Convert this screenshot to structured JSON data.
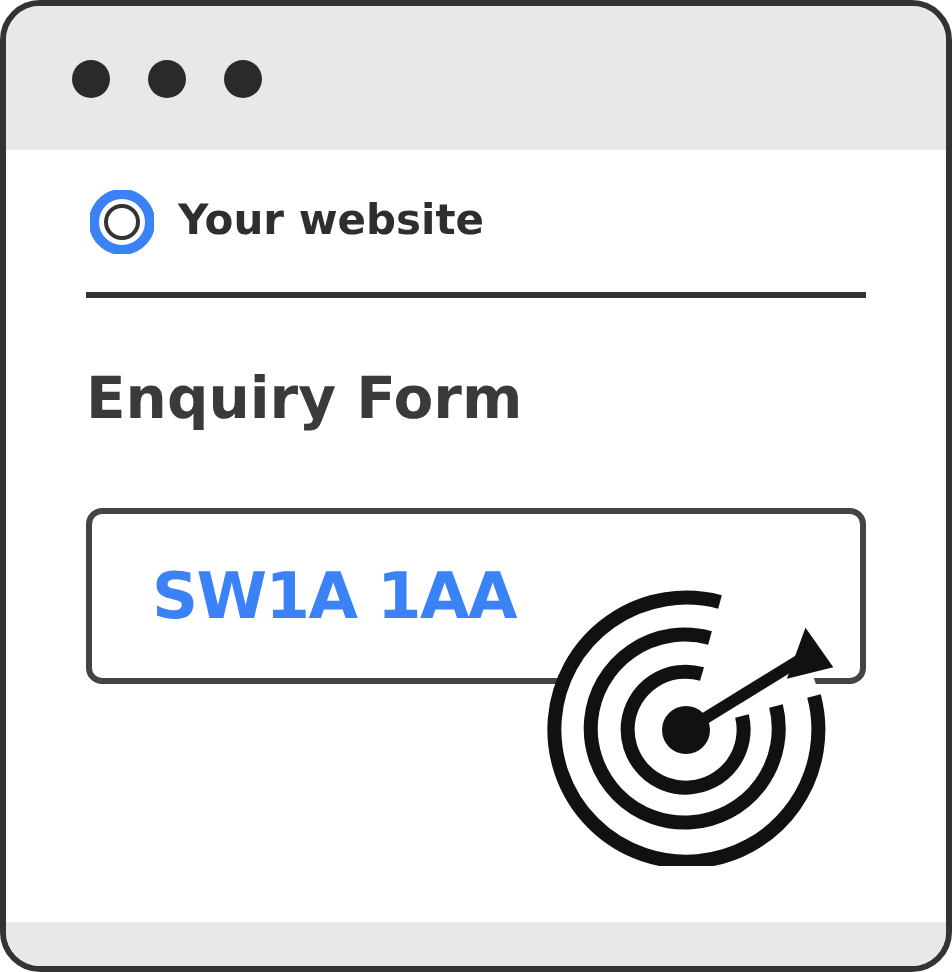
{
  "browser": {
    "site_name": "Your website"
  },
  "form": {
    "title": "Enquiry Form",
    "postcode_field": {
      "value": "SW1A 1AA"
    }
  }
}
